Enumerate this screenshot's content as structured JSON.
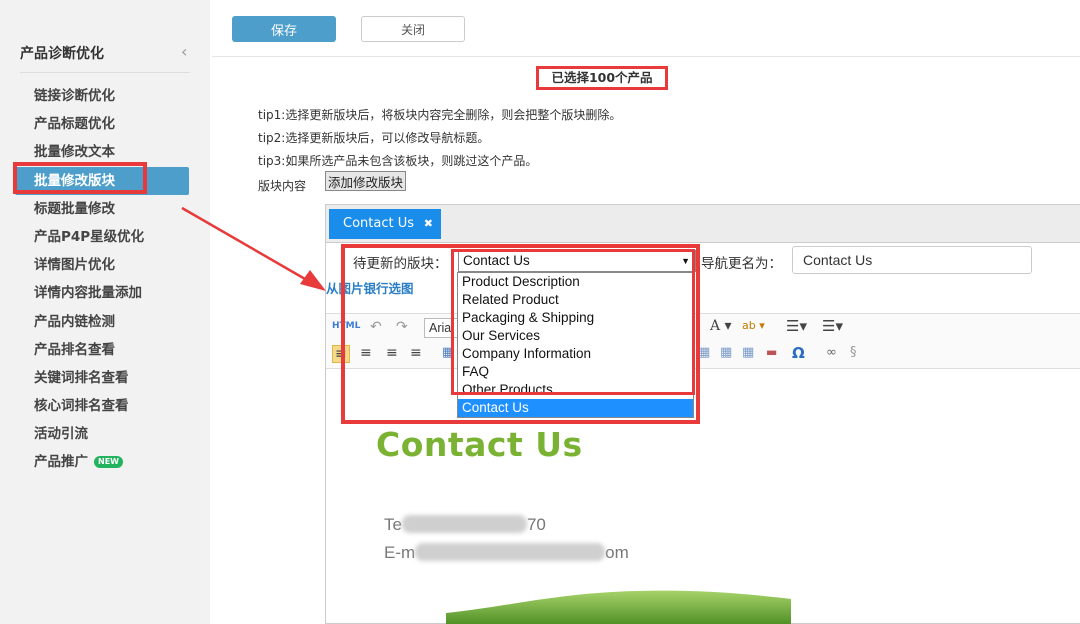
{
  "sidebar": {
    "title": "产品诊断优化",
    "collapse_icon": "‹",
    "items": [
      {
        "label": "链接诊断优化"
      },
      {
        "label": "产品标题优化"
      },
      {
        "label": "批量修改文本"
      },
      {
        "label": "批量修改版块",
        "active": true
      },
      {
        "label": "标题批量修改"
      },
      {
        "label": "产品P4P星级优化"
      },
      {
        "label": "详情图片优化"
      },
      {
        "label": "详情内容批量添加"
      },
      {
        "label": "产品内链检测"
      },
      {
        "label": "产品排名查看"
      },
      {
        "label": "关键词排名查看"
      },
      {
        "label": "核心词排名查看"
      },
      {
        "label": "活动引流"
      },
      {
        "label": "产品推广",
        "badge": "NEW"
      }
    ]
  },
  "toolbar": {
    "save_label": "保存",
    "close_label": "关闭"
  },
  "selection": {
    "count_text": "已选择100个产品"
  },
  "tips": [
    "tip1:选择更新版块后，将板块内容完全删除，则会把整个版块删除。",
    "tip2:选择更新版块后，可以修改导航标题。",
    "tip3:如果所选产品未包含该板块，则跳过这个产品。"
  ],
  "block": {
    "label": "版块内容",
    "add_button": "添加修改版块"
  },
  "editor": {
    "tab_label": "Contact Us",
    "tab_close": "✖",
    "update_block_label": "待更新的版块：",
    "selected_block": "Contact Us",
    "nav_rename_label": "导航更名为：",
    "nav_rename_value": "Contact Us",
    "from_gallery": "从图片银行选图",
    "font_name": "Arial",
    "content_heading": "Contact Us",
    "tel_prefix": "Te",
    "tel_suffix": "70",
    "email_prefix": "E-m",
    "email_suffix": "om"
  },
  "dropdown": {
    "options": [
      "Product Description",
      "Related Product",
      "Packaging & Shipping",
      "Our Services",
      "Company Information",
      "FAQ",
      "Other Products",
      "Contact Us"
    ],
    "selected_index": 7
  },
  "colors": {
    "accent_blue": "#4d9ecb",
    "tab_blue": "#1a8dea",
    "highlight_red": "#e83a3a",
    "heading_green": "#7ab333"
  }
}
